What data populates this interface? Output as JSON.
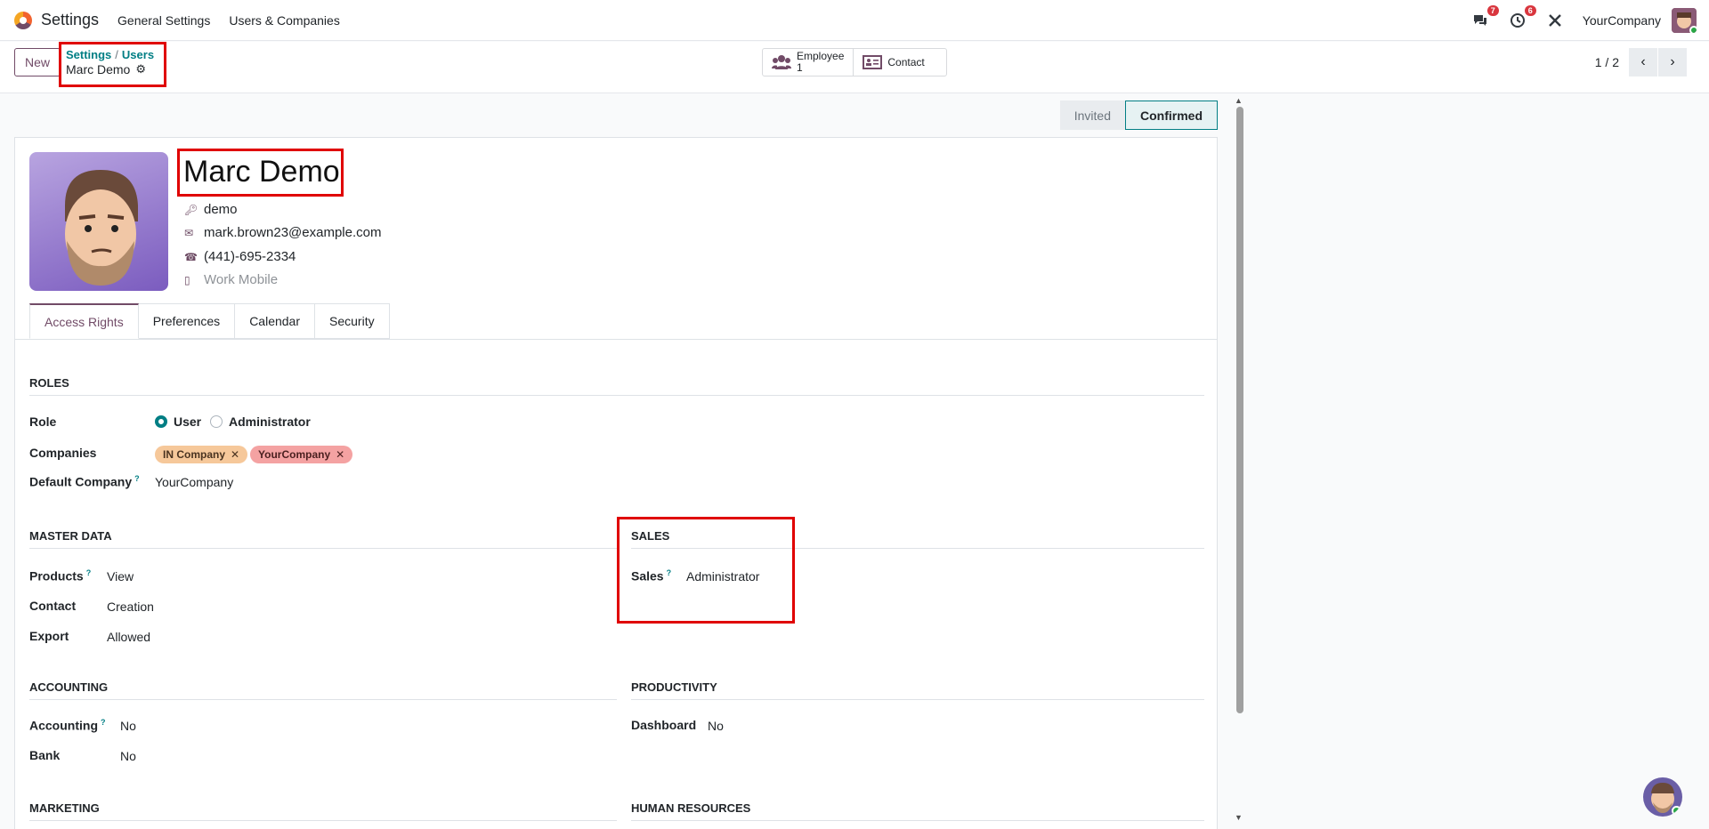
{
  "nav": {
    "app_name": "Settings",
    "menu": [
      "General Settings",
      "Users & Companies"
    ],
    "messages_badge": "7",
    "activities_badge": "6",
    "company": "YourCompany"
  },
  "control": {
    "new_label": "New",
    "breadcrumb_parent": "Settings",
    "breadcrumb_sub": "Users",
    "breadcrumb_current": "Marc Demo",
    "employee_label": "Employee",
    "employee_count": "1",
    "contact_label": "Contact",
    "pager": "1 / 2"
  },
  "status": {
    "stages": [
      "Invited",
      "Confirmed"
    ],
    "active": "Confirmed"
  },
  "user": {
    "name": "Marc Demo",
    "login": "demo",
    "email": "mark.brown23@example.com",
    "phone": "(441)-695-2334",
    "mobile_placeholder": "Work Mobile"
  },
  "tabs": [
    "Access Rights",
    "Preferences",
    "Calendar",
    "Security"
  ],
  "roles": {
    "title": "ROLES",
    "role_label": "Role",
    "role_options": [
      "User",
      "Administrator"
    ],
    "role_selected": "User",
    "companies_label": "Companies",
    "companies": [
      "IN Company",
      "YourCompany"
    ],
    "default_company_label": "Default Company",
    "default_company": "YourCompany"
  },
  "master_data": {
    "title": "MASTER DATA",
    "fields": [
      {
        "label": "Products",
        "value": "View"
      },
      {
        "label": "Contact",
        "value": "Creation"
      },
      {
        "label": "Export",
        "value": "Allowed"
      }
    ]
  },
  "sales": {
    "title": "SALES",
    "label": "Sales",
    "value": "Administrator"
  },
  "accounting": {
    "title": "ACCOUNTING",
    "fields": [
      {
        "label": "Accounting",
        "value": "No"
      },
      {
        "label": "Bank",
        "value": "No"
      }
    ]
  },
  "productivity": {
    "title": "PRODUCTIVITY",
    "label": "Dashboard",
    "value": "No"
  },
  "marketing": {
    "title": "MARKETING"
  },
  "human_resources": {
    "title": "HUMAN RESOURCES"
  },
  "colors": {
    "brand": "#714b67",
    "accent": "#017e84",
    "highlight": "#e00000",
    "tag_in_company": "#f6c89a",
    "tag_yourcompany": "#f4a2a2"
  }
}
